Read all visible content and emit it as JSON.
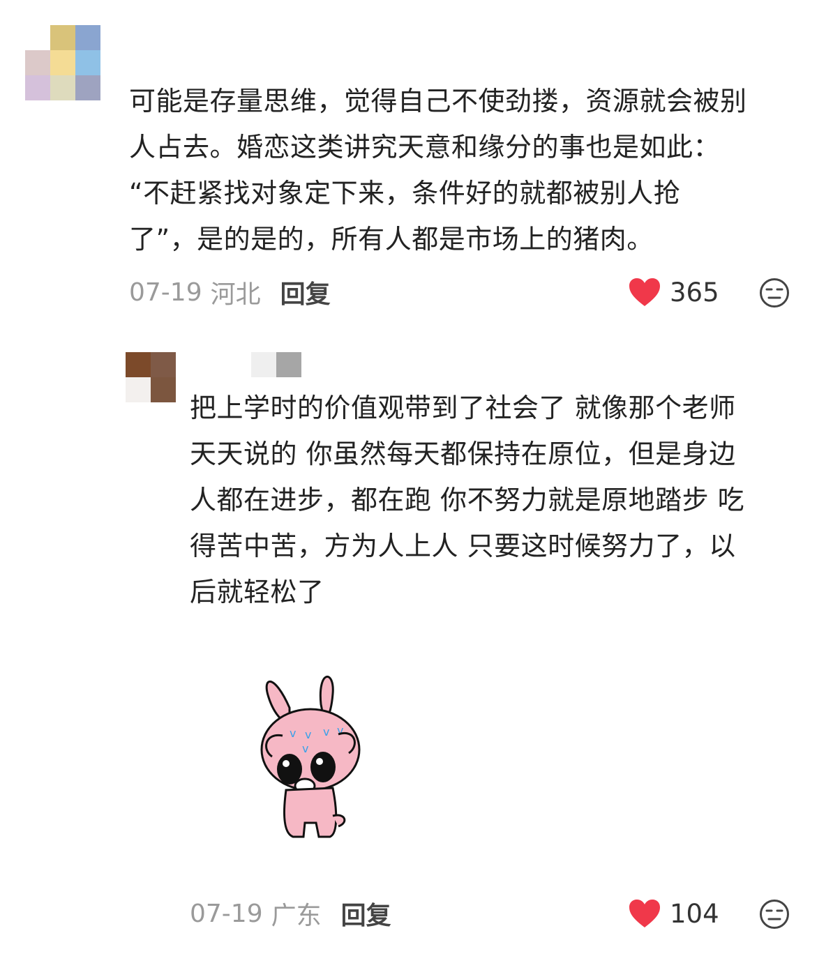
{
  "comments": [
    {
      "text": "可能是存量思维，觉得自己不使劲搂，资源就会被别\n人占去。婚恋这类讲究天意和缘分的事也是如此：\n“不赶紧找对象定下来，条件好的就都被别人抢\n了”，是的是的，所有人都是市场上的猪肉。",
      "date": "07-19",
      "region": "河北",
      "reply_label": "回复",
      "likes": "365"
    },
    {
      "text": "把上学时的价值观带到了社会了 就像那个老师\n天天说的 你虽然每天都保持在原位，但是身边\n人都在进步，都在跑 你不努力就是原地踏步 吃\n得苦中苦，方为人上人 只要这时候努力了，以\n后就轻松了",
      "date": "07-19",
      "region": "广东",
      "reply_label": "回复",
      "likes": "104"
    }
  ],
  "icons": {
    "like": "heart-icon",
    "dislike": "neutral-face-icon",
    "sticker": "crying-bunny-sticker"
  },
  "colors": {
    "heart": "#f0384a",
    "meta_gray": "#9a9a9a"
  }
}
